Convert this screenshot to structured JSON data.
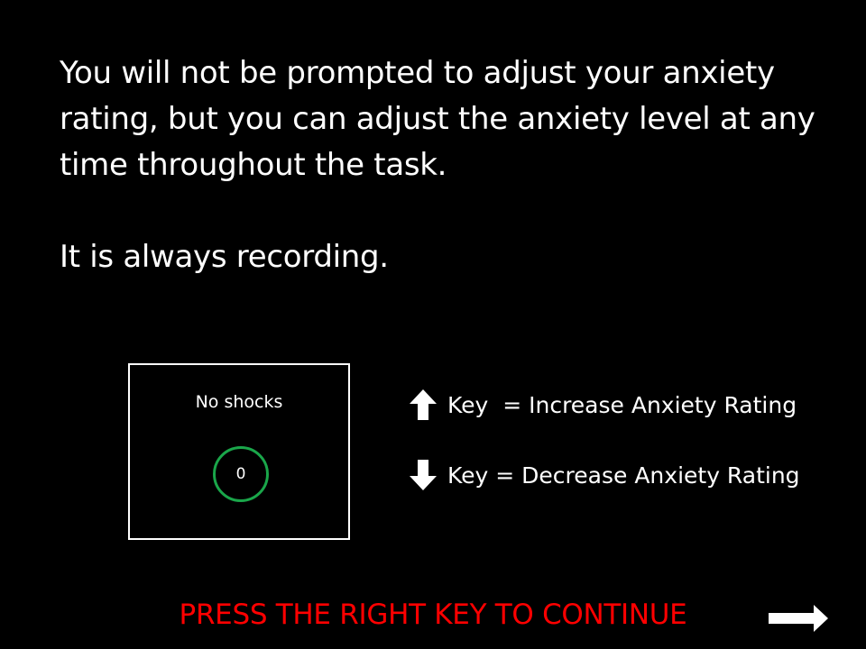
{
  "instructions": {
    "paragraph_1": "You will not be prompted to adjust your anxiety rating, but you can adjust the anxiety level at any time throughout the task.",
    "paragraph_2": "It is always recording."
  },
  "rating_box": {
    "label": "No shocks",
    "value": "0",
    "circle_color": "#1aa64a"
  },
  "key_legend": {
    "up": {
      "icon": "up-arrow-icon",
      "text": "Key  = Increase Anxiety Rating"
    },
    "down": {
      "icon": "down-arrow-icon",
      "text": "Key = Decrease Anxiety Rating"
    }
  },
  "continue_prompt": {
    "text": "PRESS THE RIGHT KEY TO CONTINUE",
    "color": "#ff0000",
    "icon": "right-arrow-icon"
  }
}
